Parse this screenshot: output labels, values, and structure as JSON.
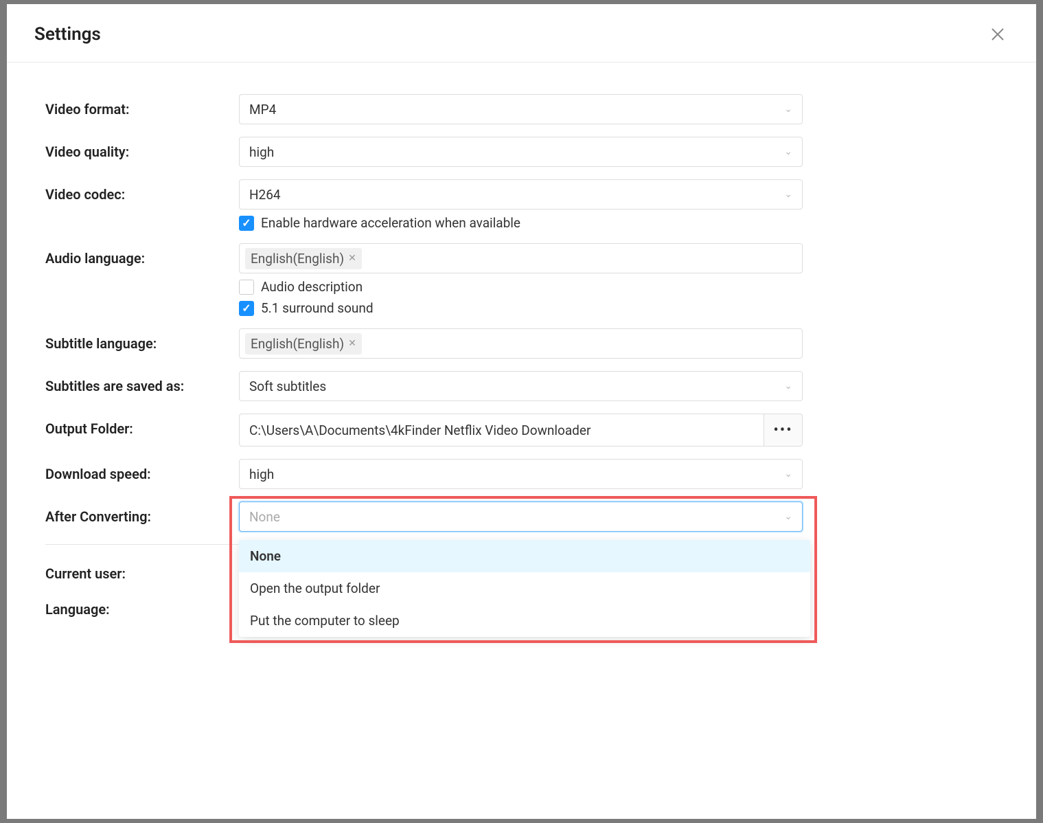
{
  "header": {
    "title": "Settings"
  },
  "fields": {
    "video_format": {
      "label": "Video format:",
      "value": "MP4"
    },
    "video_quality": {
      "label": "Video quality:",
      "value": "high"
    },
    "video_codec": {
      "label": "Video codec:",
      "value": "H264",
      "hw_accel": "Enable hardware acceleration when available"
    },
    "audio_language": {
      "label": "Audio language:",
      "tag": "English(English)",
      "audio_desc": "Audio description",
      "surround": "5.1 surround sound"
    },
    "subtitle_language": {
      "label": "Subtitle language:",
      "tag": "English(English)"
    },
    "subtitles_saved": {
      "label": "Subtitles are saved as:",
      "value": "Soft subtitles"
    },
    "output_folder": {
      "label": "Output Folder:",
      "value": "C:\\Users\\A\\Documents\\4kFinder Netflix Video Downloader"
    },
    "download_speed": {
      "label": "Download speed:",
      "value": "high"
    },
    "after_converting": {
      "label": "After Converting:",
      "placeholder": "None",
      "options": [
        "None",
        "Open the output folder",
        "Put the computer to sleep"
      ]
    },
    "current_user": {
      "label": "Current user:"
    },
    "language": {
      "label": "Language:"
    }
  }
}
